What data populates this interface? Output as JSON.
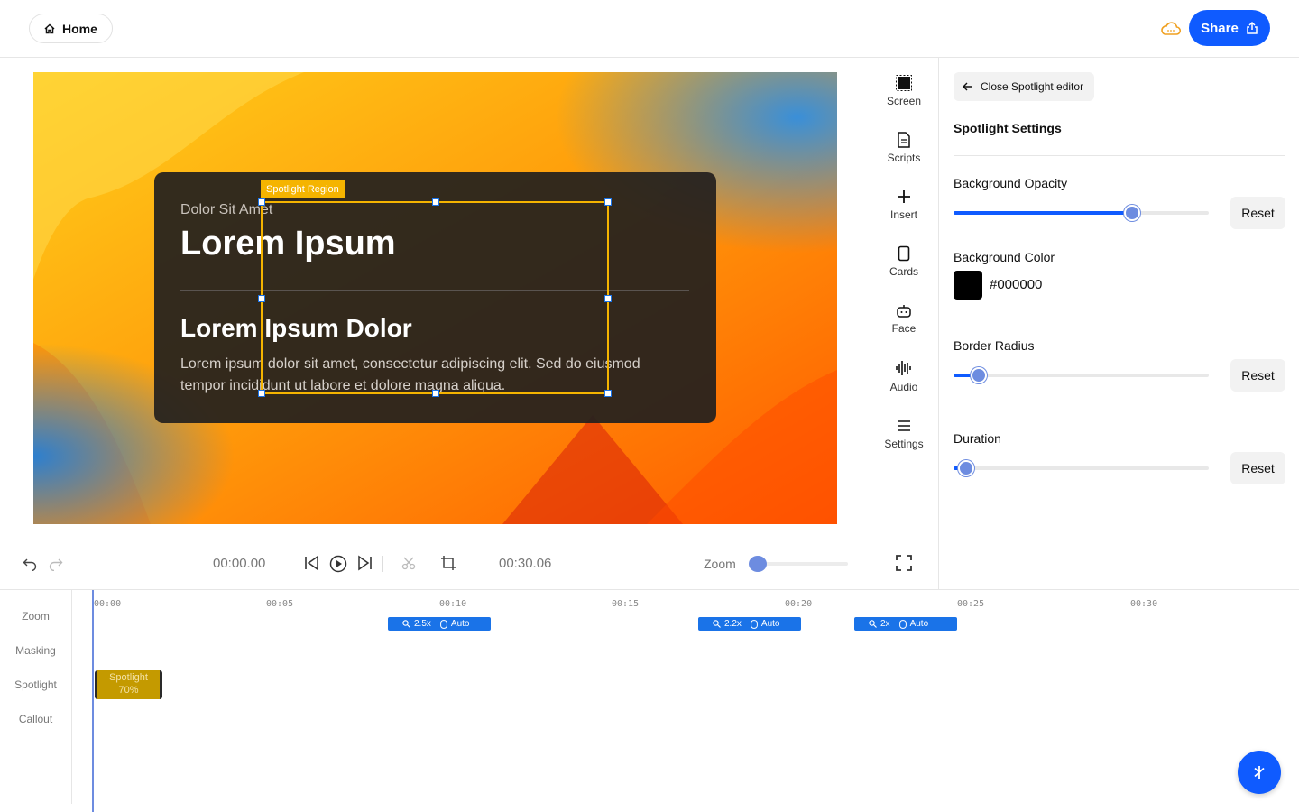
{
  "topbar": {
    "home_label": "Home",
    "share_label": "Share"
  },
  "canvas": {
    "card_subtitle": "Dolor Sit Amet",
    "card_title": "Lorem Ipsum",
    "card_heading": "Lorem Ipsum Dolor",
    "card_body": "Lorem ipsum dolor sit amet, consectetur adipiscing elit. Sed do eiusmod tempor incididunt ut labore et dolore magna aliqua.",
    "selection_tag": "Spotlight Region"
  },
  "tools": [
    {
      "label": "Screen",
      "icon": "screen-icon"
    },
    {
      "label": "Scripts",
      "icon": "document-icon"
    },
    {
      "label": "Insert",
      "icon": "plus-icon"
    },
    {
      "label": "Cards",
      "icon": "card-icon"
    },
    {
      "label": "Face",
      "icon": "robot-face-icon"
    },
    {
      "label": "Audio",
      "icon": "waveform-icon"
    },
    {
      "label": "Settings",
      "icon": "menu-icon"
    }
  ],
  "panel": {
    "close_label": "Close Spotlight editor",
    "title": "Spotlight Settings",
    "opacity_label": "Background Opacity",
    "opacity_value": 0.7,
    "color_label": "Background Color",
    "color_value": "#000000",
    "radius_label": "Border Radius",
    "radius_value": 0.1,
    "duration_label": "Duration",
    "duration_value": 0.05,
    "reset_label": "Reset"
  },
  "playback": {
    "current_time": "00:00.00",
    "total_time": "00:30.06",
    "zoom_label": "Zoom",
    "zoom_value": 0.05
  },
  "timeline": {
    "tracks": [
      "Zoom",
      "Masking",
      "Spotlight",
      "Callout"
    ],
    "ticks": [
      "00:00",
      "00:05",
      "00:10",
      "00:15",
      "00:20",
      "00:25",
      "00:30"
    ],
    "zoom_segments": [
      {
        "factor": "2.5x",
        "mode": "Auto"
      },
      {
        "factor": "2.2x",
        "mode": "Auto"
      },
      {
        "factor": "2x",
        "mode": "Auto"
      }
    ],
    "spotlight_segment": {
      "label": "Spotlight",
      "value": "70%"
    }
  },
  "colors": {
    "accent": "#0f5bff",
    "selection": "#f5b400",
    "spotlight_segment": "#c49a00"
  }
}
